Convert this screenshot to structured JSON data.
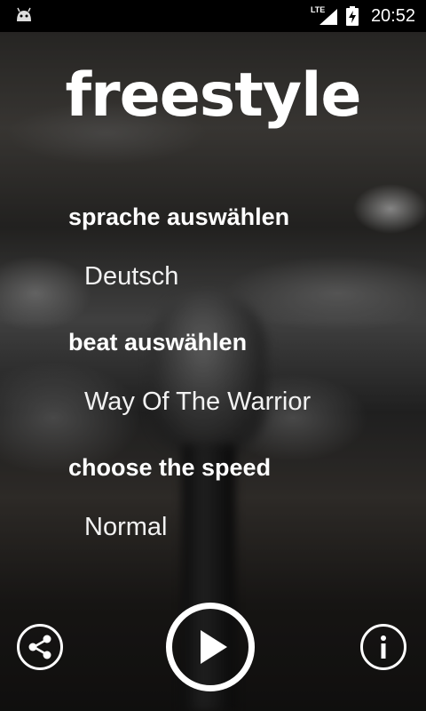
{
  "status_bar": {
    "network_label": "LTE",
    "time": "20:52",
    "icons": [
      "android-debug-icon",
      "signal-icon",
      "battery-charging-icon"
    ]
  },
  "app": {
    "title": "freestyle"
  },
  "settings": [
    {
      "heading": "sprache auswählen",
      "value": "Deutsch"
    },
    {
      "heading": "beat auswählen",
      "value": "Way Of The Warrior"
    },
    {
      "heading": "choose the speed",
      "value": "Normal"
    }
  ],
  "controls": {
    "icons": [
      "share-icon",
      "play-icon",
      "info-icon"
    ]
  }
}
